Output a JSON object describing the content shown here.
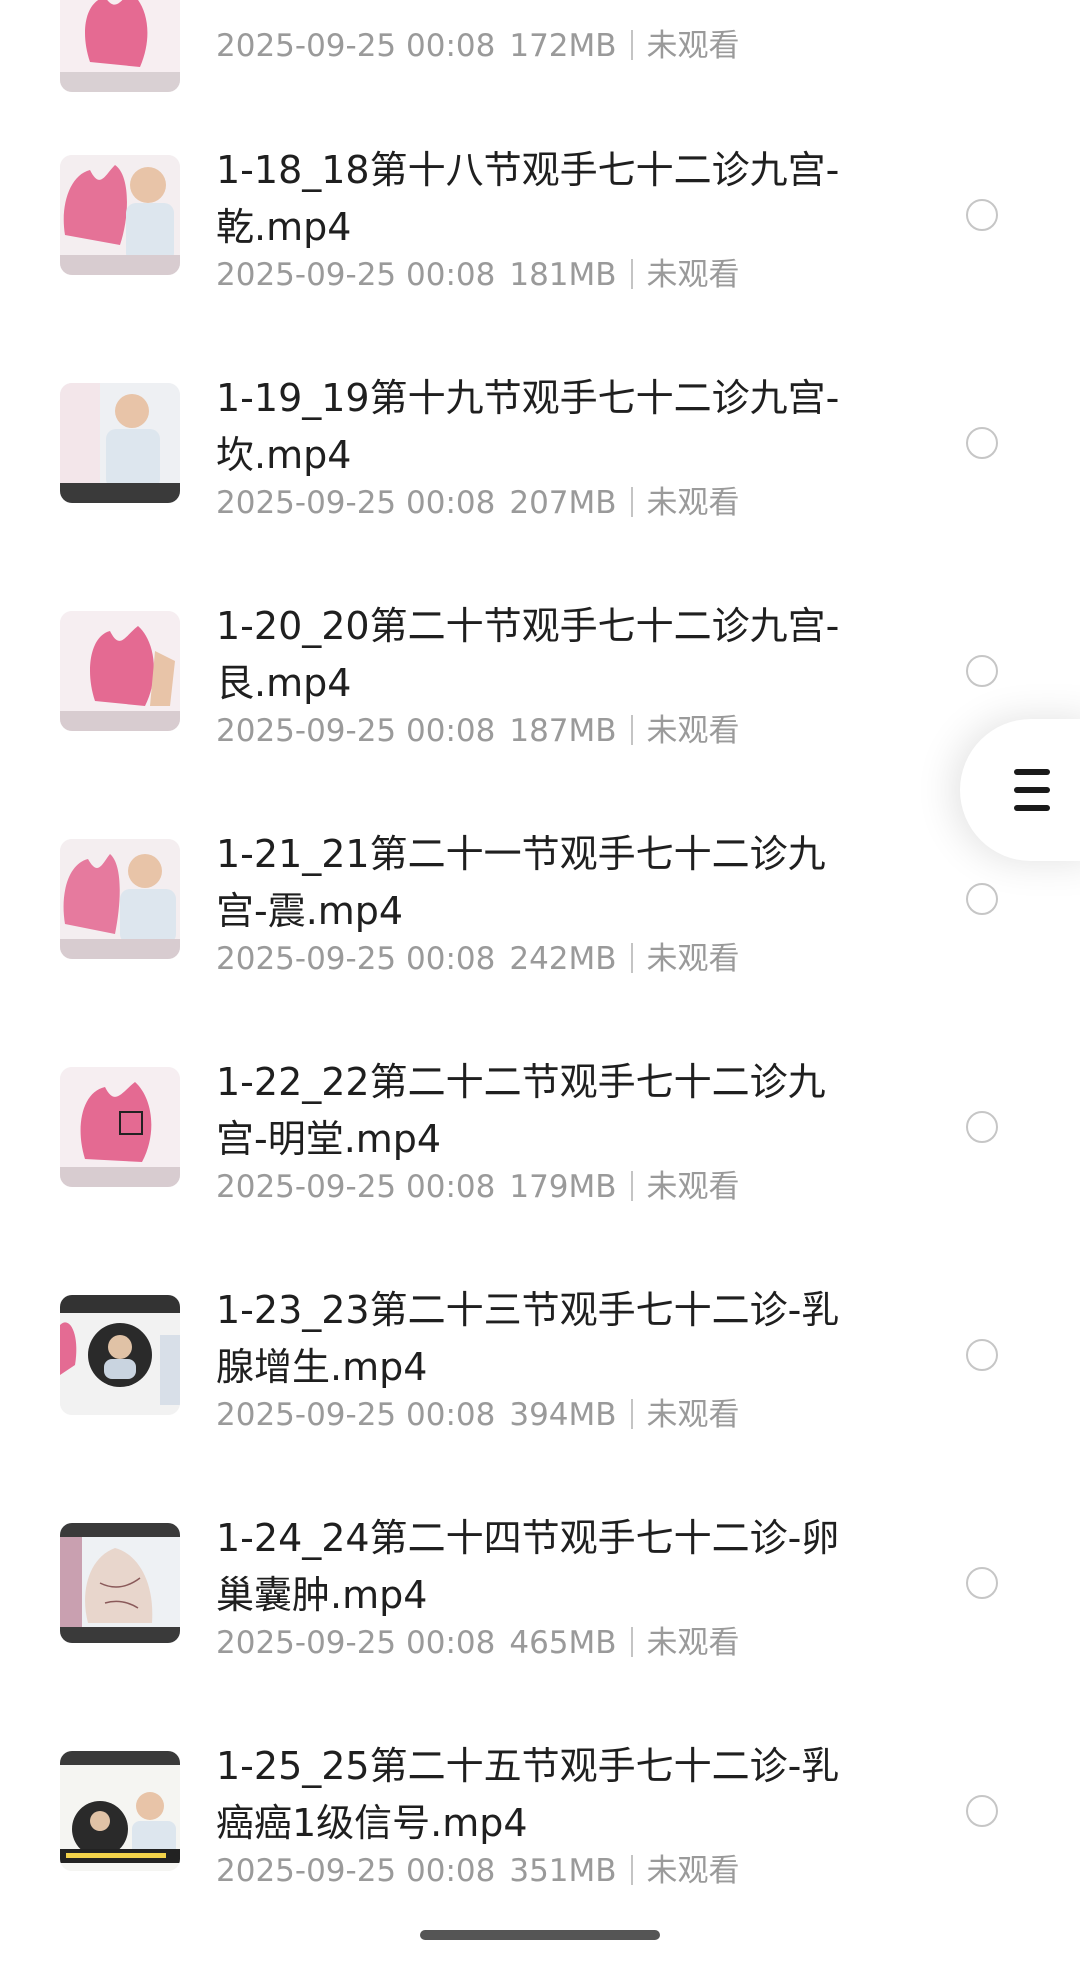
{
  "items": [
    {
      "title_line1": "",
      "title_line2": "",
      "date": "2025-09-25 00:08",
      "size": "172MB",
      "status": "未观看",
      "thumb": "palm"
    },
    {
      "title_line1": "1-18_18第十八节观手七十二诊九宫-",
      "title_line2": "乾.mp4",
      "date": "2025-09-25 00:08",
      "size": "181MB",
      "status": "未观看",
      "thumb": "palm-teacher"
    },
    {
      "title_line1": "1-19_19第十九节观手七十二诊九宫-",
      "title_line2": "坎.mp4",
      "date": "2025-09-25 00:08",
      "size": "207MB",
      "status": "未观看",
      "thumb": "teacher"
    },
    {
      "title_line1": "1-20_20第二十节观手七十二诊九宫-",
      "title_line2": "艮.mp4",
      "date": "2025-09-25 00:08",
      "size": "187MB",
      "status": "未观看",
      "thumb": "palm-hand"
    },
    {
      "title_line1": "1-21_21第二十一节观手七十二诊九",
      "title_line2": "宫-震.mp4",
      "date": "2025-09-25 00:08",
      "size": "242MB",
      "status": "未观看",
      "thumb": "palm-teacher"
    },
    {
      "title_line1": "1-22_22第二十二节观手七十二诊九",
      "title_line2": "宫-明堂.mp4",
      "date": "2025-09-25 00:08",
      "size": "179MB",
      "status": "未观看",
      "thumb": "palm"
    },
    {
      "title_line1": "1-23_23第二十三节观手七十二诊-乳",
      "title_line2": "腺增生.mp4",
      "date": "2025-09-25 00:08",
      "size": "394MB",
      "status": "未观看",
      "thumb": "circle"
    },
    {
      "title_line1": "1-24_24第二十四节观手七十二诊-卵",
      "title_line2": "巢囊肿.mp4",
      "date": "2025-09-25 00:08",
      "size": "465MB",
      "status": "未观看",
      "thumb": "hand-lines"
    },
    {
      "title_line1": "1-25_25第二十五节观手七十二诊-乳",
      "title_line2": "癌癌1级信号.mp4",
      "date": "2025-09-25 00:08",
      "size": "351MB",
      "status": "未观看",
      "thumb": "circle-caption"
    }
  ],
  "floating_menu": {
    "icon": "menu-icon"
  },
  "colors": {
    "title": "#1f1f1f",
    "meta": "#9a9a9a",
    "palm_pink": "#e0487a",
    "radio_border": "#c6c6c6"
  }
}
